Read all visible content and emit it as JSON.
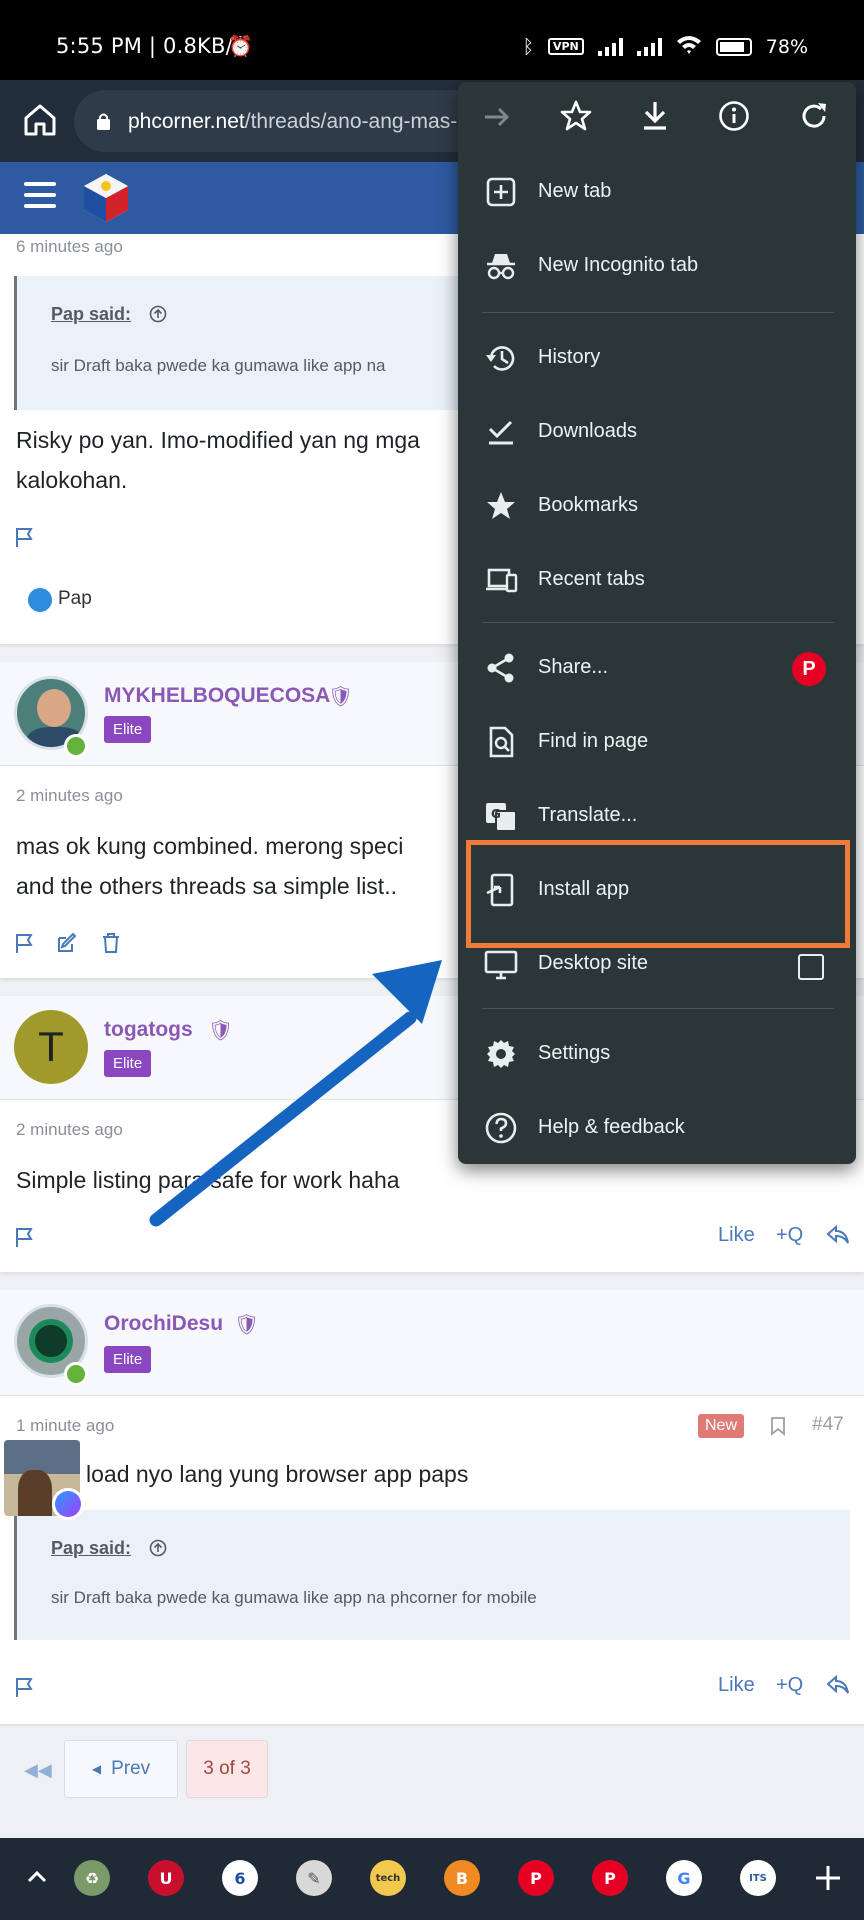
{
  "status_bar": {
    "time": "5:55 PM | 0.8KB/s",
    "battery": "78",
    "vpn": "VPN"
  },
  "browser": {
    "url_domain": "phcorner.net",
    "url_path": "/threads/ano-ang-mas-p"
  },
  "posts": [
    {
      "time": "6 minutes ago",
      "quote_author": "Pap said:",
      "quote_text": "sir Draft baka pwede ka gumawa like app na",
      "body_line1": "Risky po yan. Imo-modified yan ng mga",
      "body_line2": "kalokohan.",
      "reaction_user": "Pap"
    },
    {
      "username": "MYKHELBOQUECOSA",
      "badge": "Elite",
      "time": "2 minutes ago",
      "body_line1": "mas ok kung combined. merong speci",
      "body_line2": "and the others threads sa simple list.."
    },
    {
      "username": "togatogs",
      "avatar_letter": "T",
      "badge": "Elite",
      "time": "2 minutes ago",
      "body_line1": "Simple listing para safe for work haha",
      "like": "Like",
      "quote_action": "+Q"
    },
    {
      "username": "OrochiDesu",
      "badge": "Elite",
      "time": "1 minute ago",
      "new_badge": "New",
      "post_number": "#47",
      "body_line1": "load nyo lang yung browser app paps",
      "quote_author": "Pap said:",
      "quote_text": "sir Draft baka pwede ka gumawa like app na phcorner for mobile",
      "like": "Like",
      "quote_action": "+Q"
    }
  ],
  "pagination": {
    "prev": "Prev",
    "current": "3 of 3"
  },
  "menu": {
    "items": [
      {
        "label": "New tab",
        "icon": "new-tab-icon"
      },
      {
        "label": "New Incognito tab",
        "icon": "incognito-icon"
      },
      {
        "label": "History",
        "icon": "history-icon"
      },
      {
        "label": "Downloads",
        "icon": "downloads-icon"
      },
      {
        "label": "Bookmarks",
        "icon": "bookmarks-icon"
      },
      {
        "label": "Recent tabs",
        "icon": "recent-tabs-icon"
      },
      {
        "label": "Share...",
        "icon": "share-icon"
      },
      {
        "label": "Find in page",
        "icon": "find-icon"
      },
      {
        "label": "Translate...",
        "icon": "translate-icon"
      },
      {
        "label": "Install app",
        "icon": "install-app-icon"
      },
      {
        "label": "Desktop site",
        "icon": "desktop-icon"
      },
      {
        "label": "Settings",
        "icon": "settings-icon"
      },
      {
        "label": "Help & feedback",
        "icon": "help-icon"
      }
    ]
  },
  "colors": {
    "highlight": "#f07a3a",
    "arrow": "#1565c0",
    "menu_bg": "#2a3637",
    "username": "#8b58b5",
    "elite": "#8a47bf"
  }
}
